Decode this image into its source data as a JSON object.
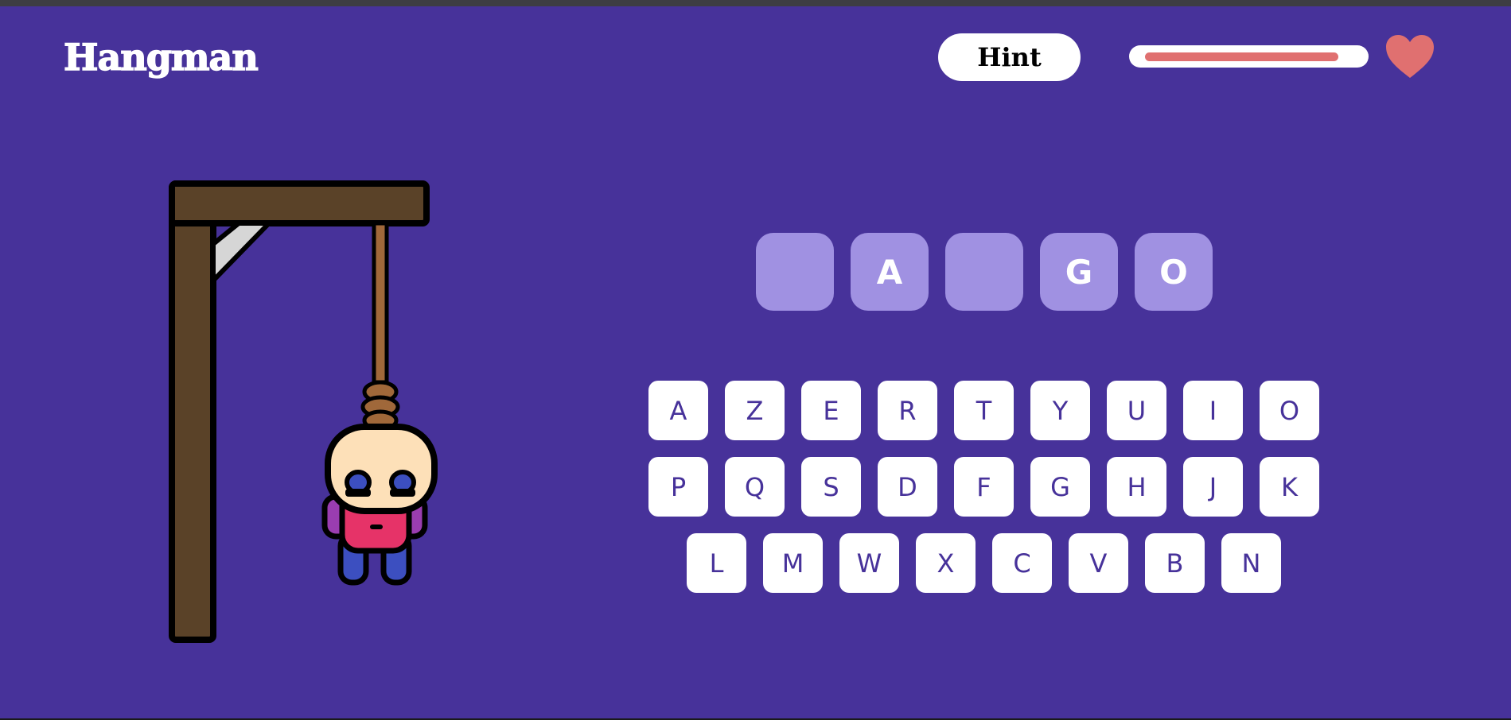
{
  "header": {
    "title": "Hangman",
    "hint_label": "Hint",
    "health": 0.93,
    "health_color": "#e07070",
    "heart_icon": "heart-icon",
    "heart_color": "#e07070"
  },
  "colors": {
    "background": "#47329a",
    "slot": "#a091e2",
    "key_text": "#47329a",
    "gallows_wood": "#5a4228"
  },
  "word": {
    "slots": [
      "",
      "A",
      "",
      "G",
      "O"
    ]
  },
  "keyboard": {
    "rows": [
      [
        "A",
        "Z",
        "E",
        "R",
        "T",
        "Y",
        "U",
        "I",
        "O"
      ],
      [
        "P",
        "Q",
        "S",
        "D",
        "F",
        "G",
        "H",
        "J",
        "K"
      ],
      [
        "L",
        "M",
        "W",
        "X",
        "C",
        "V",
        "B",
        "N"
      ]
    ]
  }
}
